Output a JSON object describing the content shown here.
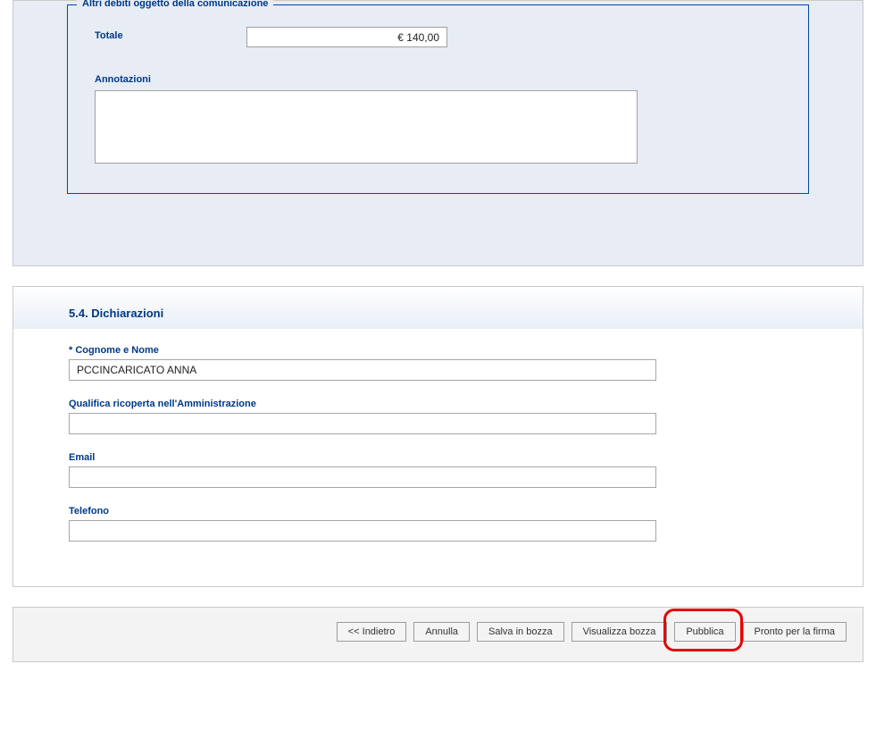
{
  "fieldset": {
    "legend": "Altri debiti oggetto della comunicazione",
    "totale_label": "Totale",
    "totale_value": "€ 140,00",
    "annotazioni_label": "Annotazioni",
    "annotazioni_value": ""
  },
  "section2": {
    "title": "5.4. Dichiarazioni",
    "cognome_label": "* Cognome e Nome",
    "cognome_value": "PCCINCARICATO ANNA",
    "qualifica_label": "Qualifica ricoperta nell'Amministrazione",
    "qualifica_value": "",
    "email_label": "Email",
    "email_value": "",
    "telefono_label": "Telefono",
    "telefono_value": ""
  },
  "buttons": {
    "indietro": "<< Indietro",
    "annulla": "Annulla",
    "salva": "Salva in bozza",
    "visualizza": "Visualizza bozza",
    "pubblica": "Pubblica",
    "pronto": "Pronto per la firma"
  }
}
